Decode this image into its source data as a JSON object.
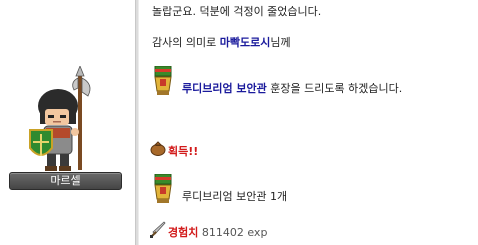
{
  "npc": {
    "name": "마르셀"
  },
  "dialog": {
    "line1": "놀랍군요. 덕분에 걱정이 줄었습니다.",
    "line2_prefix": "감사의 의미로 ",
    "line2_npc": "마빡도로시",
    "line2_suffix": "님께",
    "reward_item_name": "루디브리엄 보안관",
    "reward_line_suffix": " 훈장을 드리도록 하겠습니다.",
    "obtain_label": "획득!!",
    "item_received": "루디브리엄 보안관 1개",
    "exp_label": "경험치",
    "exp_value": "811402 exp"
  },
  "icons": {
    "medal": "medal-icon",
    "bag": "money-bag-icon",
    "exp": "sword-icon"
  },
  "colors": {
    "link_blue": "#1a1a9c",
    "obtain_red": "#d21a1a"
  }
}
